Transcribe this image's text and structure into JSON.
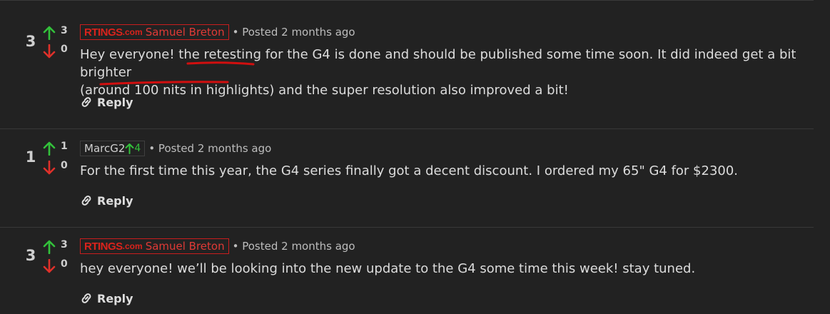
{
  "comments": [
    {
      "score": "3",
      "upvotes": "3",
      "downvotes": "0",
      "brand": "RTINGS",
      "brand_suffix": ".com",
      "author": "Samuel Breton",
      "posted": "• Posted 2 months ago",
      "body_line1": "Hey everyone! the retesting for the G4 is done and should be published some time soon. It did indeed get a bit brighter",
      "body_line2": "(around 100 nits in highlights) and the super resolution also improved a bit!",
      "reply": "Reply"
    },
    {
      "score": "1",
      "upvotes": "1",
      "downvotes": "0",
      "author": "MarcG2",
      "reputation": "4",
      "posted": "• Posted 2 months ago",
      "body_line1": "For the first time this year, the G4 series finally got a decent discount.  I ordered my 65\" G4 for $2300.",
      "reply": "Reply"
    },
    {
      "score": "3",
      "upvotes": "3",
      "downvotes": "0",
      "brand": "RTINGS",
      "brand_suffix": ".com",
      "author": "Samuel Breton",
      "posted": "• Posted 2 months ago",
      "body_line1": "hey everyone! we’ll be looking into the new update to the G4 some time this week! stay tuned.",
      "reply": "Reply"
    }
  ],
  "colors": {
    "background": "#222222",
    "upvote": "#33c13b",
    "downvote": "#e0302a",
    "brand": "#d9231c",
    "annotation": "#d10f0f"
  },
  "icons": [
    "arrow-up-icon",
    "arrow-down-icon",
    "link-icon"
  ]
}
